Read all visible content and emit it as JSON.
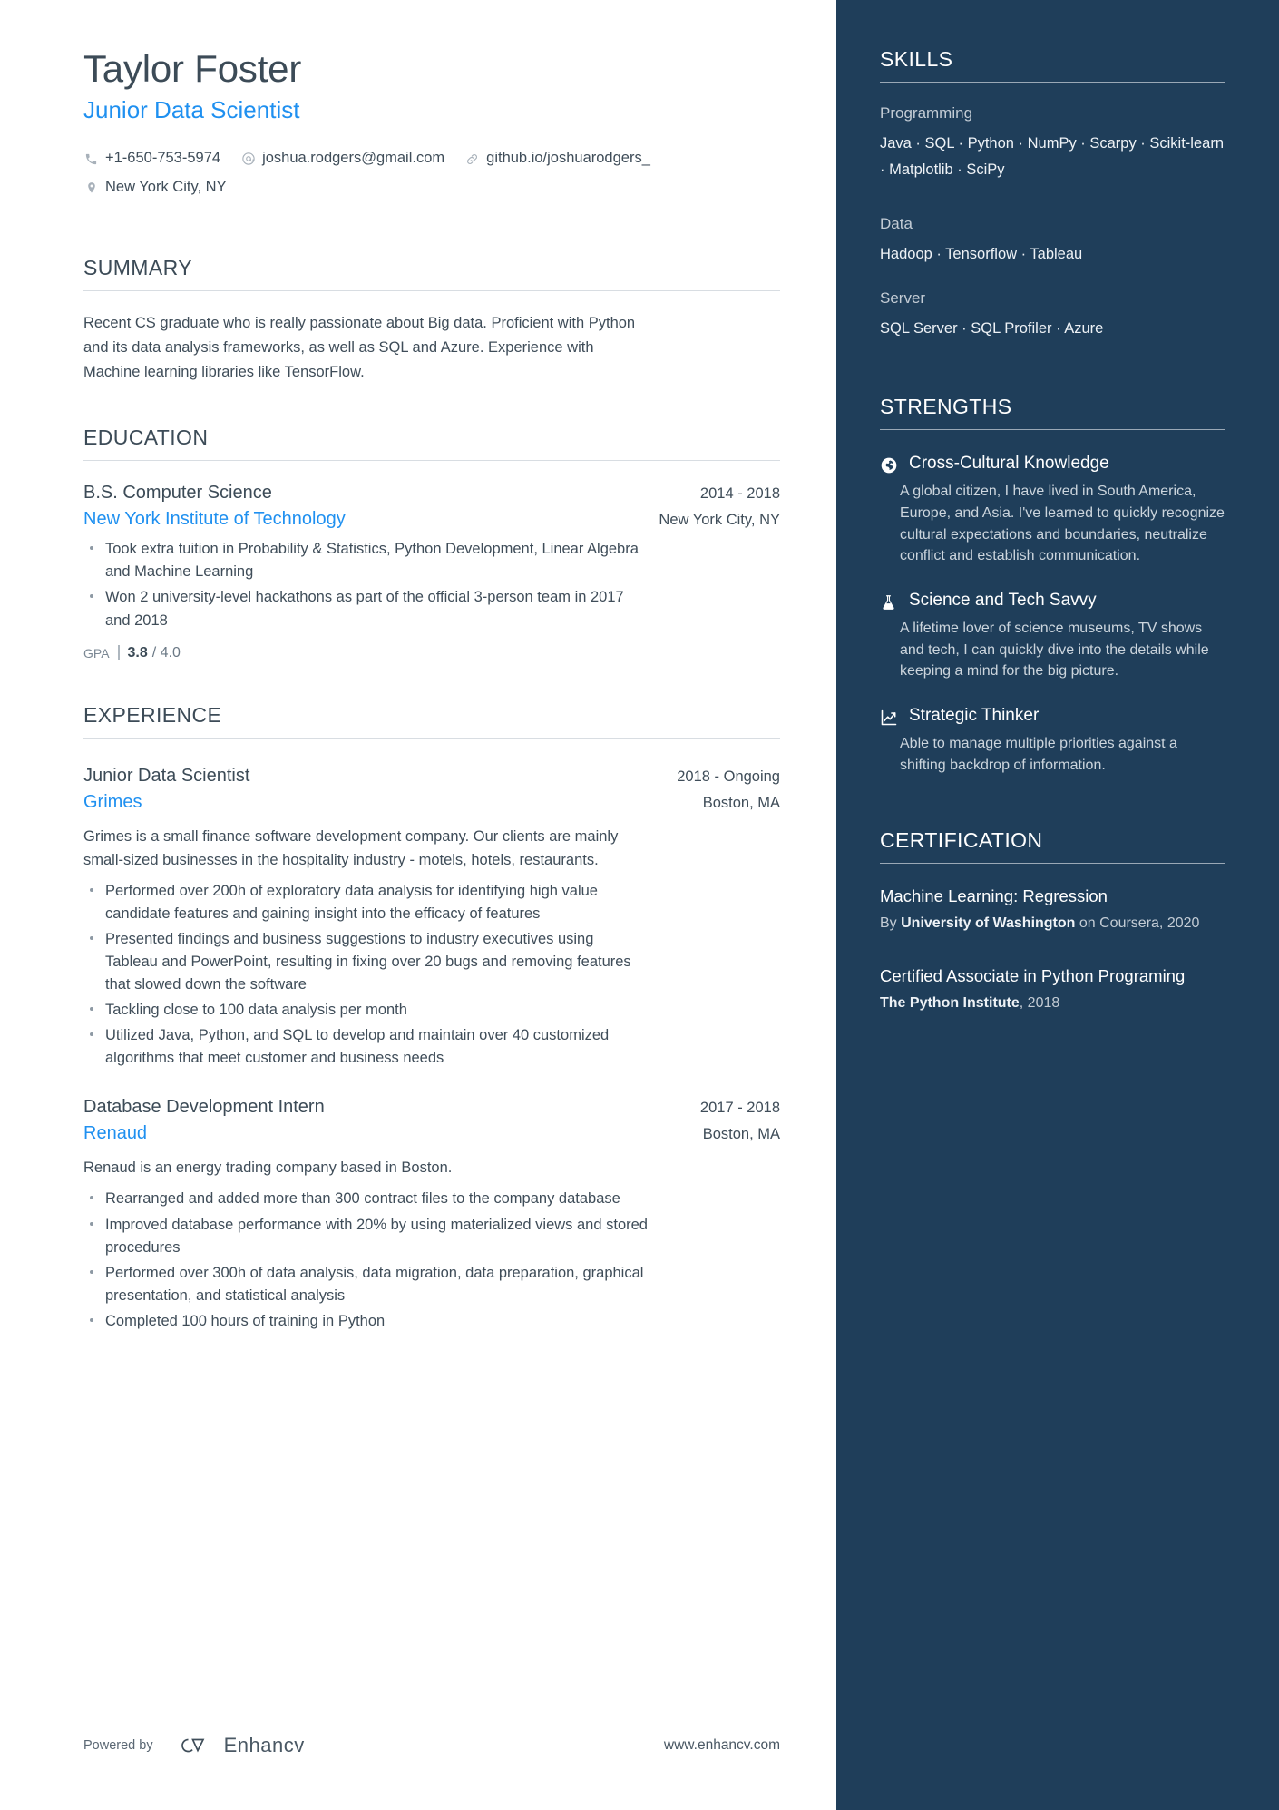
{
  "header": {
    "name": "Taylor Foster",
    "job_title": "Junior Data Scientist",
    "contacts": [
      {
        "icon": "phone-icon",
        "text": "+1-650-753-5974"
      },
      {
        "icon": "email-icon",
        "text": "joshua.rodgers@gmail.com"
      },
      {
        "icon": "link-icon",
        "text": "github.io/joshuarodgers_"
      }
    ],
    "location": {
      "icon": "location-pin-icon",
      "text": "New York City, NY"
    }
  },
  "summary": {
    "title": "SUMMARY",
    "text": "Recent CS graduate who is really passionate about Big data. Proficient with Python and its data analysis frameworks, as well as SQL and Azure. Experience with Machine learning libraries like TensorFlow."
  },
  "education": {
    "title": "EDUCATION",
    "entries": [
      {
        "degree": "B.S. Computer Science",
        "date": "2014 - 2018",
        "school": "New York Institute of Technology",
        "location": "New York City, NY",
        "bullets": [
          "Took extra tuition in Probability & Statistics, Python Development, Linear Algebra and Machine Learning",
          "Won 2 university-level hackathons as part of the official 3-person team in 2017 and 2018"
        ],
        "gpa_label": "GPA",
        "gpa_value": "3.8",
        "gpa_max": "/ 4.0"
      }
    ]
  },
  "experience": {
    "title": "EXPERIENCE",
    "entries": [
      {
        "role": "Junior Data Scientist",
        "date": "2018 - Ongoing",
        "company": "Grimes",
        "location": "Boston, MA",
        "description": "Grimes is a small finance software development company. Our clients are mainly small-sized businesses in the hospitality industry - motels, hotels, restaurants.",
        "bullets": [
          "Performed over 200h of exploratory data analysis for identifying high value candidate features and gaining insight into the efficacy of features",
          "Presented findings and business suggestions to industry executives using Tableau and PowerPoint, resulting in fixing over 20 bugs and removing features that slowed down the software",
          "Tackling close to 100 data analysis per month",
          "Utilized Java, Python, and SQL to develop and maintain over 40 customized algorithms that meet customer and business needs"
        ]
      },
      {
        "role": "Database Development Intern",
        "date": "2017 - 2018",
        "company": "Renaud",
        "location": "Boston, MA",
        "description": "Renaud is an energy trading company based in Boston.",
        "bullets": [
          "Rearranged and added more than 300 contract files to the company database",
          "Improved database performance with 20% by using materialized views and stored procedures",
          "Performed over 300h of data analysis, data migration, data preparation, graphical presentation, and statistical analysis",
          "Completed 100 hours of training in Python"
        ]
      }
    ]
  },
  "skills": {
    "title": "SKILLS",
    "groups": [
      {
        "label": "Programming",
        "items": "Java · SQL · Python · NumPy · Scarpy · Scikit-learn · Matplotlib · SciPy"
      },
      {
        "label": "Data",
        "items": "Hadoop · Tensorflow · Tableau"
      },
      {
        "label": "Server",
        "items": "SQL Server · SQL Profiler · Azure"
      }
    ]
  },
  "strengths": {
    "title": "STRENGTHS",
    "items": [
      {
        "icon": "globe-icon",
        "name": "Cross-Cultural Knowledge",
        "desc": "A global citizen, I have lived in South America, Europe, and Asia. I've learned to quickly recognize cultural expectations and boundaries, neutralize conflict and establish communication."
      },
      {
        "icon": "flask-icon",
        "name": "Science and Tech Savvy",
        "desc": "A lifetime lover of science museums, TV shows and tech, I can quickly dive into the details while keeping a mind for the big picture."
      },
      {
        "icon": "trend-up-icon",
        "name": "Strategic Thinker",
        "desc": "Able to manage multiple priorities against a shifting backdrop of information."
      }
    ]
  },
  "certification": {
    "title": "CERTIFICATION",
    "items": [
      {
        "name": "Machine Learning: Regression",
        "meta_prefix": "By ",
        "meta_bold": "University of Washington",
        "meta_suffix": " on Coursera, 2020"
      },
      {
        "name": "Certified Associate in Python Programing",
        "meta_prefix": "",
        "meta_bold": "The Python Institute",
        "meta_suffix": ", 2018"
      }
    ]
  },
  "footer": {
    "powered_by": "Powered by",
    "brand": "Enhancv",
    "url": "www.enhancv.com"
  },
  "colors": {
    "accent_blue": "#1f90f0",
    "sidebar_navy": "#1f3e5a",
    "heading": "#3c4b57"
  }
}
